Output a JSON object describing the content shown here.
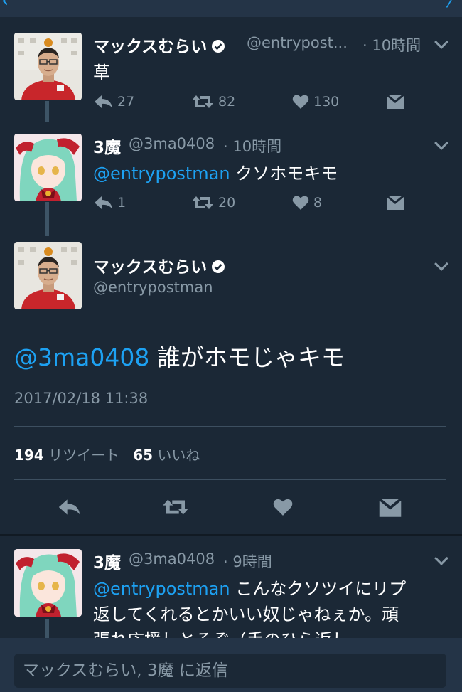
{
  "tweets": [
    {
      "name": "マックスむらい",
      "handle": "@entrypost...",
      "time": "· 10時間",
      "text": "草",
      "reply_count": "27",
      "retweet_count": "82",
      "like_count": "130"
    },
    {
      "name": "3魔",
      "handle": "@3ma0408",
      "time": "· 10時間",
      "mention": "@entrypostman",
      "text": "クソホモキモ",
      "reply_count": "1",
      "retweet_count": "20",
      "like_count": "8"
    }
  ],
  "focused": {
    "name": "マックスむらい",
    "handle": "@entrypostman",
    "mention": "@3ma0408",
    "text": "誰がホモじゃキモ",
    "timestamp": "2017/02/18 11:38",
    "retweet_count": "194",
    "retweet_label": "リツイート",
    "like_count": "65",
    "like_label": "いいね"
  },
  "reply": {
    "name": "3魔",
    "handle": "@3ma0408",
    "time": "· 9時間",
    "mention": "@entrypostman",
    "line1": "こんなクソツイにリプ",
    "line2": "返してくれるとかいい奴じゃねぇか。頑",
    "line3": "張れ応援しとるぞ（手のひら返し"
  },
  "composer": {
    "placeholder": "マックスむらい, 3魔 に返信"
  },
  "colors": {
    "background": "#1b2836",
    "accent": "#1da1f2",
    "muted": "#8899a6"
  }
}
